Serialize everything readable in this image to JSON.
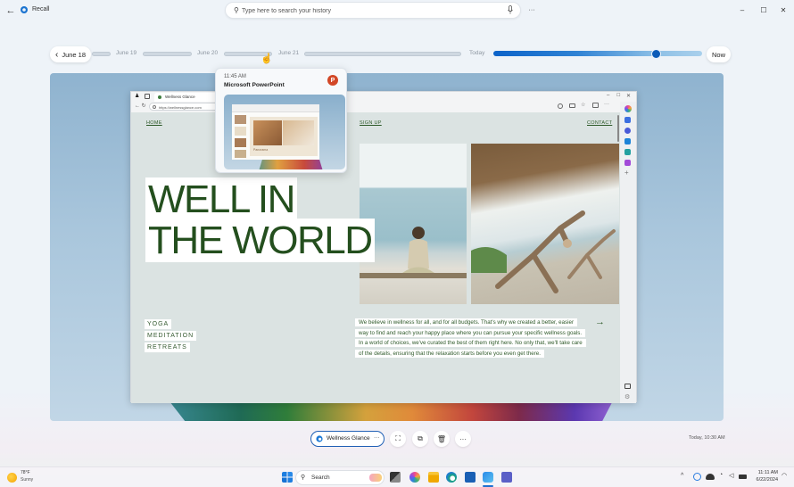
{
  "window": {
    "title": "Recall",
    "back_icon": "←",
    "minimize_icon": "–",
    "maximize_icon": "☐",
    "close_icon": "✕"
  },
  "search": {
    "placeholder": "Type here to search your history",
    "value": "",
    "search_icon": "⚲",
    "more_icon": "···"
  },
  "timeline": {
    "back_button_label": "June 18",
    "back_chevron": "‹",
    "labels": [
      "June 19",
      "June 20",
      "June 21",
      "Today"
    ],
    "now_button_label": "Now",
    "slider_position_percent": 78,
    "accent_color": "#0c63c9"
  },
  "preview_tooltip": {
    "time": "11:45 AM",
    "app_name": "Microsoft PowerPoint",
    "app_icon_letter": "P",
    "slide_caption": "Panorama"
  },
  "snapshot": {
    "browser": {
      "tab_title": "Wellness Glance",
      "url": "https://wellnessglance.com",
      "nav": [
        "HOME",
        "SIGN UP",
        "CONTACT"
      ],
      "hero_lines": [
        "WELL IN",
        "THE WORLD"
      ],
      "tags": [
        "YOGA",
        "MEDITATION",
        "RETREATS"
      ],
      "paragraph": "We believe in wellness for all, and for all budgets. That's why we created a better, easier way to find and reach your happy place where you can pursue your specific wellness goals. In a world of choices, we've curated the best of them right here. No only that, we'll take care of the details, ensuring that the relaxation starts before you even get there.",
      "arrow": "→",
      "text_color": "#244f1e"
    }
  },
  "bottom_bar": {
    "app_chip_label": "Wellness Glance",
    "app_chip_more": "···",
    "actions": [
      "screenshot-select",
      "copy",
      "delete",
      "more"
    ],
    "action_glyphs": [
      "⛶",
      "⧉",
      "🗑",
      "···"
    ],
    "timestamp": "Today, 10:30 AM"
  },
  "taskbar": {
    "weather_temp": "78°F",
    "weather_desc": "Sunny",
    "search_label": "Search",
    "tray_chevron": "^",
    "time": "11:11 AM",
    "date": "6/22/2024",
    "bell_icon": "🔔"
  }
}
